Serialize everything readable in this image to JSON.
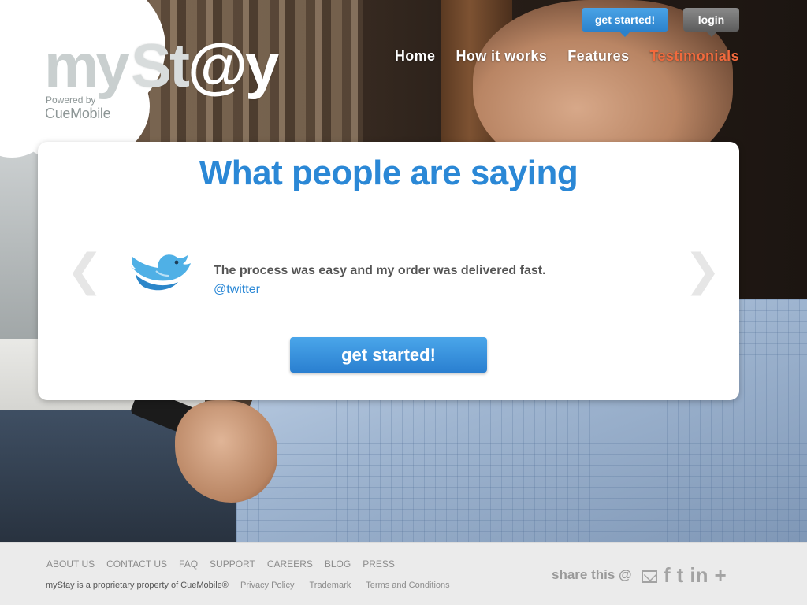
{
  "brand": {
    "logo_my": "my",
    "logo_stay_s": "St",
    "logo_stay_rest": "@y",
    "powered_by": "Powered by",
    "company": "CueMobile"
  },
  "top_buttons": {
    "get_started": "get started!",
    "login": "login"
  },
  "nav": {
    "items": [
      {
        "label": "Home",
        "active": false
      },
      {
        "label": "How it works",
        "active": false
      },
      {
        "label": "Features",
        "active": false
      },
      {
        "label": "Testimonials",
        "active": true
      }
    ]
  },
  "testimonials": {
    "title": "What people are saying",
    "quote": "The process was easy and my order was delivered fast.",
    "handle": "@twitter",
    "prev_icon": "chevron-left-icon",
    "next_icon": "chevron-right-icon",
    "bird_icon": "twitter-bird-icon",
    "cta": "get started!"
  },
  "footer": {
    "links": [
      "ABOUT US",
      "CONTACT US",
      "FAQ",
      "SUPPORT",
      "CAREERS",
      "BLOG",
      "PRESS"
    ],
    "copyright": "myStay is a proprietary property of CueMobile®",
    "legal": [
      "Privacy Policy",
      "Trademark",
      "Terms and Conditions"
    ],
    "share_label": "share this @",
    "share_icons": [
      "mail-icon",
      "facebook-icon",
      "twitter-icon",
      "linkedin-icon",
      "plus-icon"
    ],
    "share_glyphs": {
      "facebook": "f",
      "twitter": "t",
      "linkedin": "in",
      "plus": "+"
    }
  },
  "colors": {
    "accent_blue": "#2b88d6",
    "active_nav": "#f26a3d",
    "footer_bg": "#ebebeb"
  }
}
